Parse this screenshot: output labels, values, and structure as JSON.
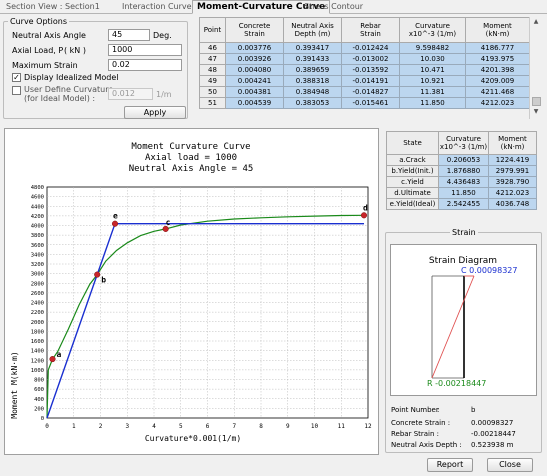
{
  "tabs": [
    {
      "label": "Section View : Section1",
      "active": false
    },
    {
      "label": "Interaction Curve",
      "active": false
    },
    {
      "label": "Moment-Curvature Curve",
      "active": true
    },
    {
      "label": "Stress Contour",
      "active": false
    }
  ],
  "curve_options": {
    "title": "Curve Options",
    "neutral_axis_angle_label": "Neutral Axis Angle",
    "neutral_axis_angle_value": "45",
    "neutral_axis_angle_unit": "Deg.",
    "axial_load_label": "Axial Load, P",
    "axial_load_unit": "( kN )",
    "axial_load_value": "1000",
    "max_strain_label": "Maximum Strain",
    "max_strain_value": "0.02",
    "display_idealized_label": "Display Idealized Model",
    "display_idealized_checked": true,
    "user_define_label": "User Define Curvature",
    "user_define_label2": "(for Ideal Model) :",
    "user_define_checked": false,
    "user_define_value": "0.012",
    "user_define_unit": "1/m",
    "apply_label": "Apply"
  },
  "top_table": {
    "headers": [
      "Point",
      "Concrete\nStrain",
      "Neutral Axis\nDepth (m)",
      "Rebar\nStrain",
      "Curvature\nx10^-3 (1/m)",
      "Moment\n(kN·m)"
    ],
    "rows": [
      [
        "46",
        "0.003776",
        "0.393417",
        "-0.012424",
        "9.598482",
        "4186.777"
      ],
      [
        "47",
        "0.003926",
        "0.391433",
        "-0.013002",
        "10.030",
        "4193.975"
      ],
      [
        "48",
        "0.004080",
        "0.389659",
        "-0.013592",
        "10.471",
        "4201.398"
      ],
      [
        "49",
        "0.004241",
        "0.388318",
        "-0.014191",
        "10.921",
        "4209.009"
      ],
      [
        "50",
        "0.004381",
        "0.384948",
        "-0.014827",
        "11.381",
        "4211.468"
      ],
      [
        "51",
        "0.004539",
        "0.383053",
        "-0.015461",
        "11.850",
        "4212.023"
      ]
    ]
  },
  "state_table": {
    "headers": [
      "State",
      "Curvature\nx10^-3 (1/m)",
      "Moment\n(kN·m)"
    ],
    "rows": [
      [
        "a.Crack",
        "0.206053",
        "1224.419"
      ],
      [
        "b.Yield(Init.)",
        "1.876880",
        "2979.991"
      ],
      [
        "c.Yield",
        "4.436483",
        "3928.790"
      ],
      [
        "d.Ultimate",
        "11.850",
        "4212.023"
      ],
      [
        "e.Yield(Ideal)",
        "2.542455",
        "4036.748"
      ]
    ]
  },
  "chart_data": {
    "type": "line",
    "title": "Moment Curvature Curve",
    "subtitle1": "Axial load = 1000",
    "subtitle2": "Neutral Axis Angle = 45",
    "xlabel": "Curvature*0.001(1/m)",
    "ylabel": "Moment M(kN·m)",
    "xlim": [
      0,
      12
    ],
    "ylim": [
      0,
      4800
    ],
    "xticks": [
      0,
      1,
      2,
      3,
      4,
      5,
      6,
      7,
      8,
      9,
      10,
      11,
      12
    ],
    "yticks": [
      0,
      200,
      400,
      600,
      800,
      1000,
      1200,
      1400,
      1600,
      1800,
      2000,
      2200,
      2400,
      2600,
      2800,
      3000,
      3200,
      3400,
      3600,
      3800,
      4000,
      4200,
      4400,
      4600,
      4800
    ],
    "grid": true,
    "series": [
      {
        "name": "",
        "color": "#1a8a1a",
        "x": [
          0,
          0.05,
          0.206,
          0.4,
          0.8,
          1.2,
          1.6,
          1.877,
          2.2,
          2.6,
          3.0,
          3.5,
          4.0,
          4.436,
          5.0,
          6.0,
          7.0,
          8.0,
          9.0,
          10.0,
          11.0,
          11.85
        ],
        "y": [
          0,
          1000,
          1224,
          1380,
          1850,
          2350,
          2780,
          2980,
          3260,
          3480,
          3640,
          3790,
          3880,
          3929,
          4010,
          4090,
          4135,
          4160,
          4180,
          4195,
          4207,
          4212
        ]
      },
      {
        "name": "",
        "color": "#1a2fd0",
        "x": [
          0,
          2.542,
          11.85
        ],
        "y": [
          0,
          4037,
          4037
        ]
      }
    ],
    "points": [
      {
        "label": "a",
        "x": 0.206,
        "y": 1224
      },
      {
        "label": "b",
        "x": 1.877,
        "y": 2980
      },
      {
        "label": "c",
        "x": 4.436,
        "y": 3929
      },
      {
        "label": "d",
        "x": 11.85,
        "y": 4212
      },
      {
        "label": "e",
        "x": 2.542,
        "y": 4037
      }
    ],
    "point_color": "#c8262a"
  },
  "strain": {
    "group_title": "Strain",
    "title": "Strain Diagram",
    "c_label": "C  0.00098327",
    "r_label": "R  -0.00218447",
    "info": [
      {
        "label": "Point Number",
        "sep": ":",
        "value": "b"
      },
      {
        "label": "Concrete Strain :",
        "sep": "",
        "value": "0.00098327"
      },
      {
        "label": "Rebar Strain :",
        "sep": "",
        "value": "-0.00218447"
      },
      {
        "label": "Neutral Axis Depth :",
        "sep": "",
        "value": "0.523938 m"
      }
    ]
  },
  "footer": {
    "report_label": "Report",
    "close_label": "Close"
  }
}
